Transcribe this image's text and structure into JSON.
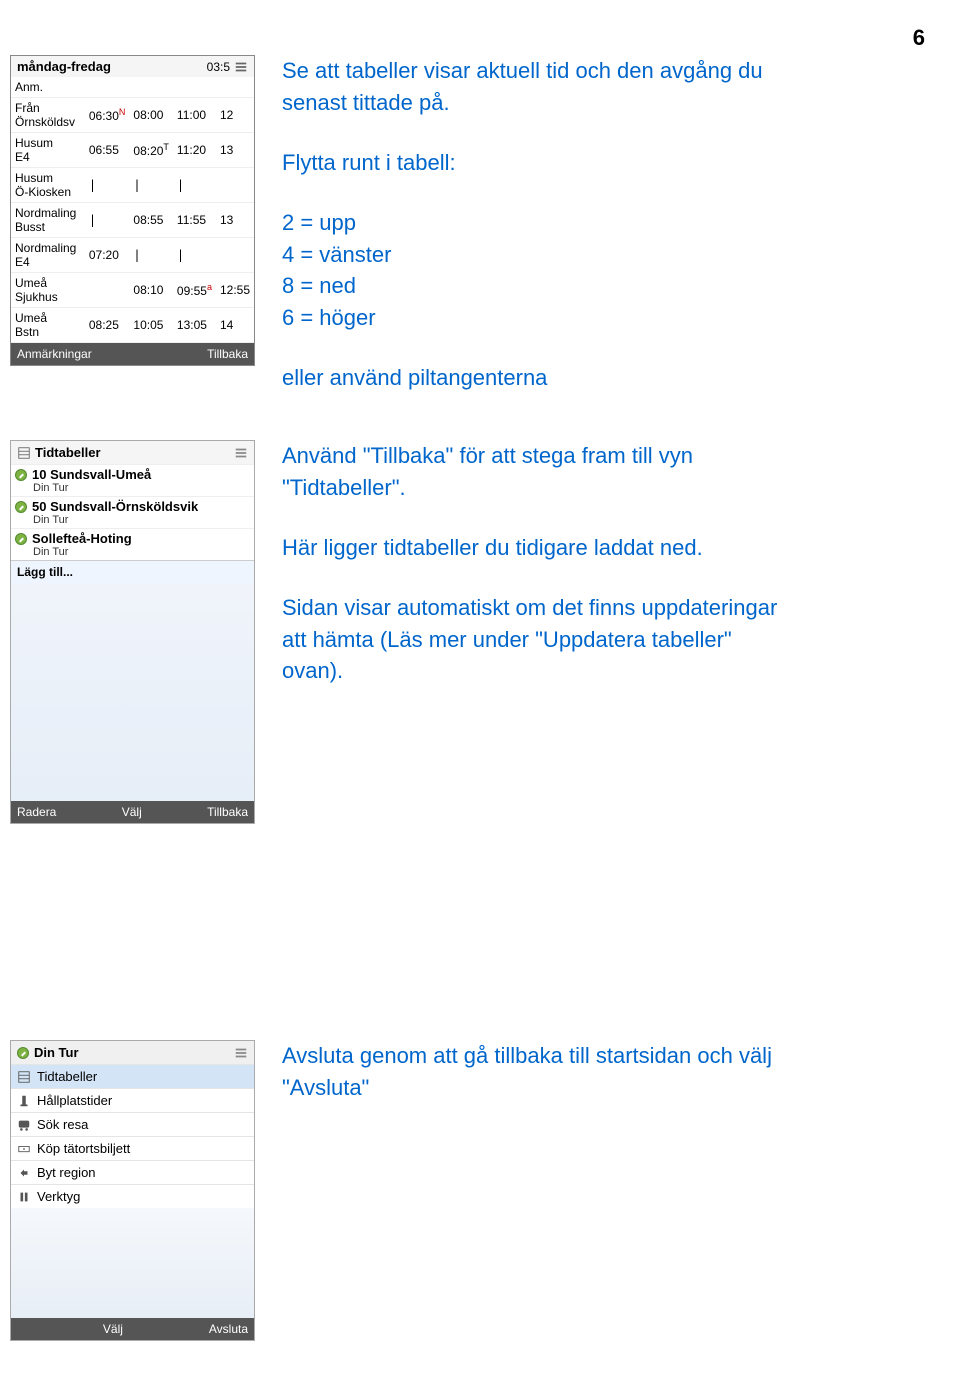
{
  "page_number": "6",
  "section1": {
    "titlebar": "måndag-fredag",
    "titlebar_right": "03:5",
    "rows": [
      {
        "label": "Anm.",
        "c1": "",
        "c2": "",
        "c3": "",
        "c4": ""
      },
      {
        "label": "Från Örnsköldsv",
        "c1": "06:30",
        "sup1": "N",
        "c2": "08:00",
        "c3": "11:00",
        "c4": "12"
      },
      {
        "label": "Husum E4",
        "c1": "06:55",
        "c2": "08:20",
        "sup2": "T",
        "c3": "11:20",
        "c4": "13"
      },
      {
        "label": "Husum Ö-Kiosken",
        "c1": "|",
        "c2": "|",
        "c3": "|",
        "c4": ""
      },
      {
        "label": "Nordmaling Busst",
        "c1": "|",
        "c2": "08:55",
        "c3": "11:55",
        "c4": "13"
      },
      {
        "label": "Nordmaling E4",
        "c1": "07:20",
        "c2": "|",
        "c3": "|",
        "c4": ""
      },
      {
        "label": "Umeå Sjukhus",
        "c1": "",
        "c2": "08:10",
        "c3": "09:55",
        "sup3": "a",
        "c4": "12:55"
      },
      {
        "label": "Umeå Bstn",
        "c1": "08:25",
        "c2": "10:05",
        "c3": "13:05",
        "c4": "14"
      }
    ],
    "footer_left": "Anmärkningar",
    "footer_right": "Tillbaka",
    "instructions": {
      "p1": "Se att tabeller visar aktuell tid och den avgång du senast tittade på.",
      "p2": "Flytta runt i tabell:",
      "l1": "2 = upp",
      "l2": "4 = vänster",
      "l3": "8 = ned",
      "l4": "6 = höger",
      "p3": "eller använd piltangenterna"
    }
  },
  "section2": {
    "title": "Tidtabeller",
    "items": [
      {
        "main": "10 Sundsvall-Umeå",
        "sub": "Din Tur"
      },
      {
        "main": "50 Sundsvall-Örnsköldsvik",
        "sub": "Din Tur"
      },
      {
        "main": "Sollefteå-Hoting",
        "sub": "Din Tur"
      }
    ],
    "add": "Lägg till...",
    "footer_left": "Radera",
    "footer_mid": "Välj",
    "footer_right": "Tillbaka",
    "instructions": {
      "p1": "Använd \"Tillbaka\" för att stega fram till vyn \"Tidtabeller\".",
      "p2": "Här ligger tidtabeller du tidigare laddat ned.",
      "p3": "Sidan visar automatiskt om det finns uppdateringar att hämta (Läs mer under \"Uppdatera tabeller\" ovan)."
    }
  },
  "section3": {
    "header": "Din Tur",
    "menu": [
      {
        "icon": "timetable",
        "label": "Tidtabeller",
        "selected": true
      },
      {
        "icon": "stop",
        "label": "Hållplatstider"
      },
      {
        "icon": "search",
        "label": "Sök resa"
      },
      {
        "icon": "ticket",
        "label": "Köp tätortsbiljett"
      },
      {
        "icon": "region",
        "label": "Byt region"
      },
      {
        "icon": "tools",
        "label": "Verktyg"
      }
    ],
    "footer_mid": "Välj",
    "footer_right": "Avsluta",
    "instructions": {
      "p1": "Avsluta genom att gå tillbaka till startsidan och välj \"Avsluta\""
    }
  }
}
